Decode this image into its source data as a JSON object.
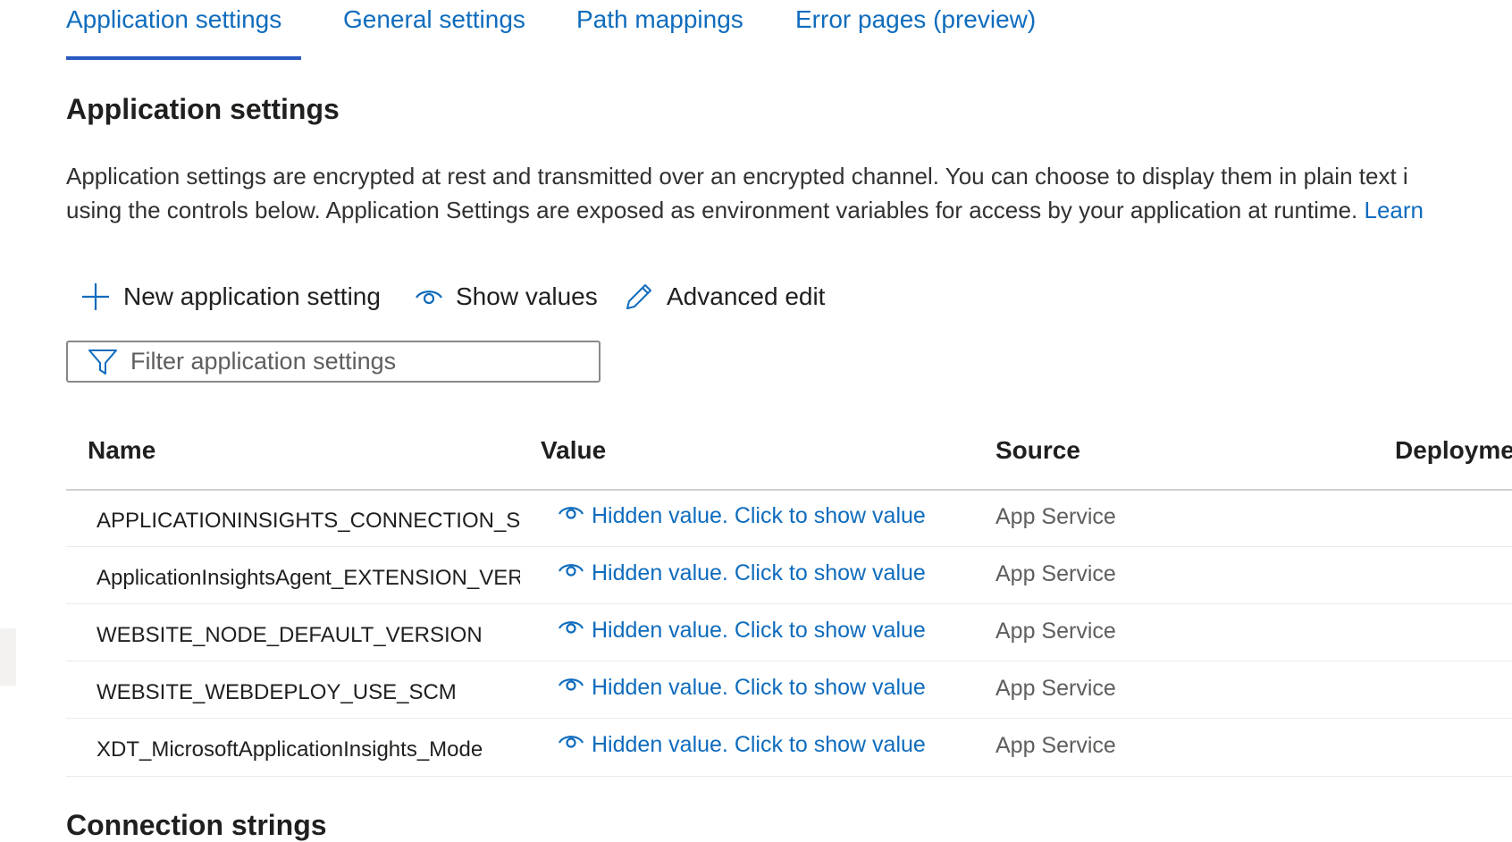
{
  "tabs": [
    {
      "label": "Application settings",
      "active": true
    },
    {
      "label": "General settings",
      "active": false
    },
    {
      "label": "Path mappings",
      "active": false
    },
    {
      "label": "Error pages (preview)",
      "active": false
    }
  ],
  "section": {
    "title": "Application settings",
    "description_line1": "Application settings are encrypted at rest and transmitted over an encrypted channel. You can choose to display them in plain text i",
    "description_line2": "using the controls below. Application Settings are exposed as environment variables for access by your application at runtime.",
    "learn_link": "Learn"
  },
  "toolbar": {
    "new_label": "New application setting",
    "show_label": "Show values",
    "advanced_label": "Advanced edit"
  },
  "filter": {
    "placeholder": "Filter application settings",
    "value": ""
  },
  "table": {
    "headers": [
      "Name",
      "Value",
      "Source",
      "Deployme"
    ],
    "rows": [
      {
        "name": "APPLICATIONINSIGHTS_CONNECTION_STRIN",
        "value": "Hidden value. Click to show value",
        "source": "App Service"
      },
      {
        "name": "ApplicationInsightsAgent_EXTENSION_VERSI(",
        "value": "Hidden value. Click to show value",
        "source": "App Service"
      },
      {
        "name": "WEBSITE_NODE_DEFAULT_VERSION",
        "value": "Hidden value. Click to show value",
        "source": "App Service"
      },
      {
        "name": "WEBSITE_WEBDEPLOY_USE_SCM",
        "value": "Hidden value. Click to show value",
        "source": "App Service"
      },
      {
        "name": "XDT_MicrosoftApplicationInsights_Mode",
        "value": "Hidden value. Click to show value",
        "source": "App Service"
      }
    ]
  },
  "next_section": {
    "title": "Connection strings"
  },
  "colors": {
    "accent": "#0f6cbd",
    "tab_underline": "#2b59c3",
    "muted_text": "#605e5c",
    "divider": "#edebe9"
  }
}
